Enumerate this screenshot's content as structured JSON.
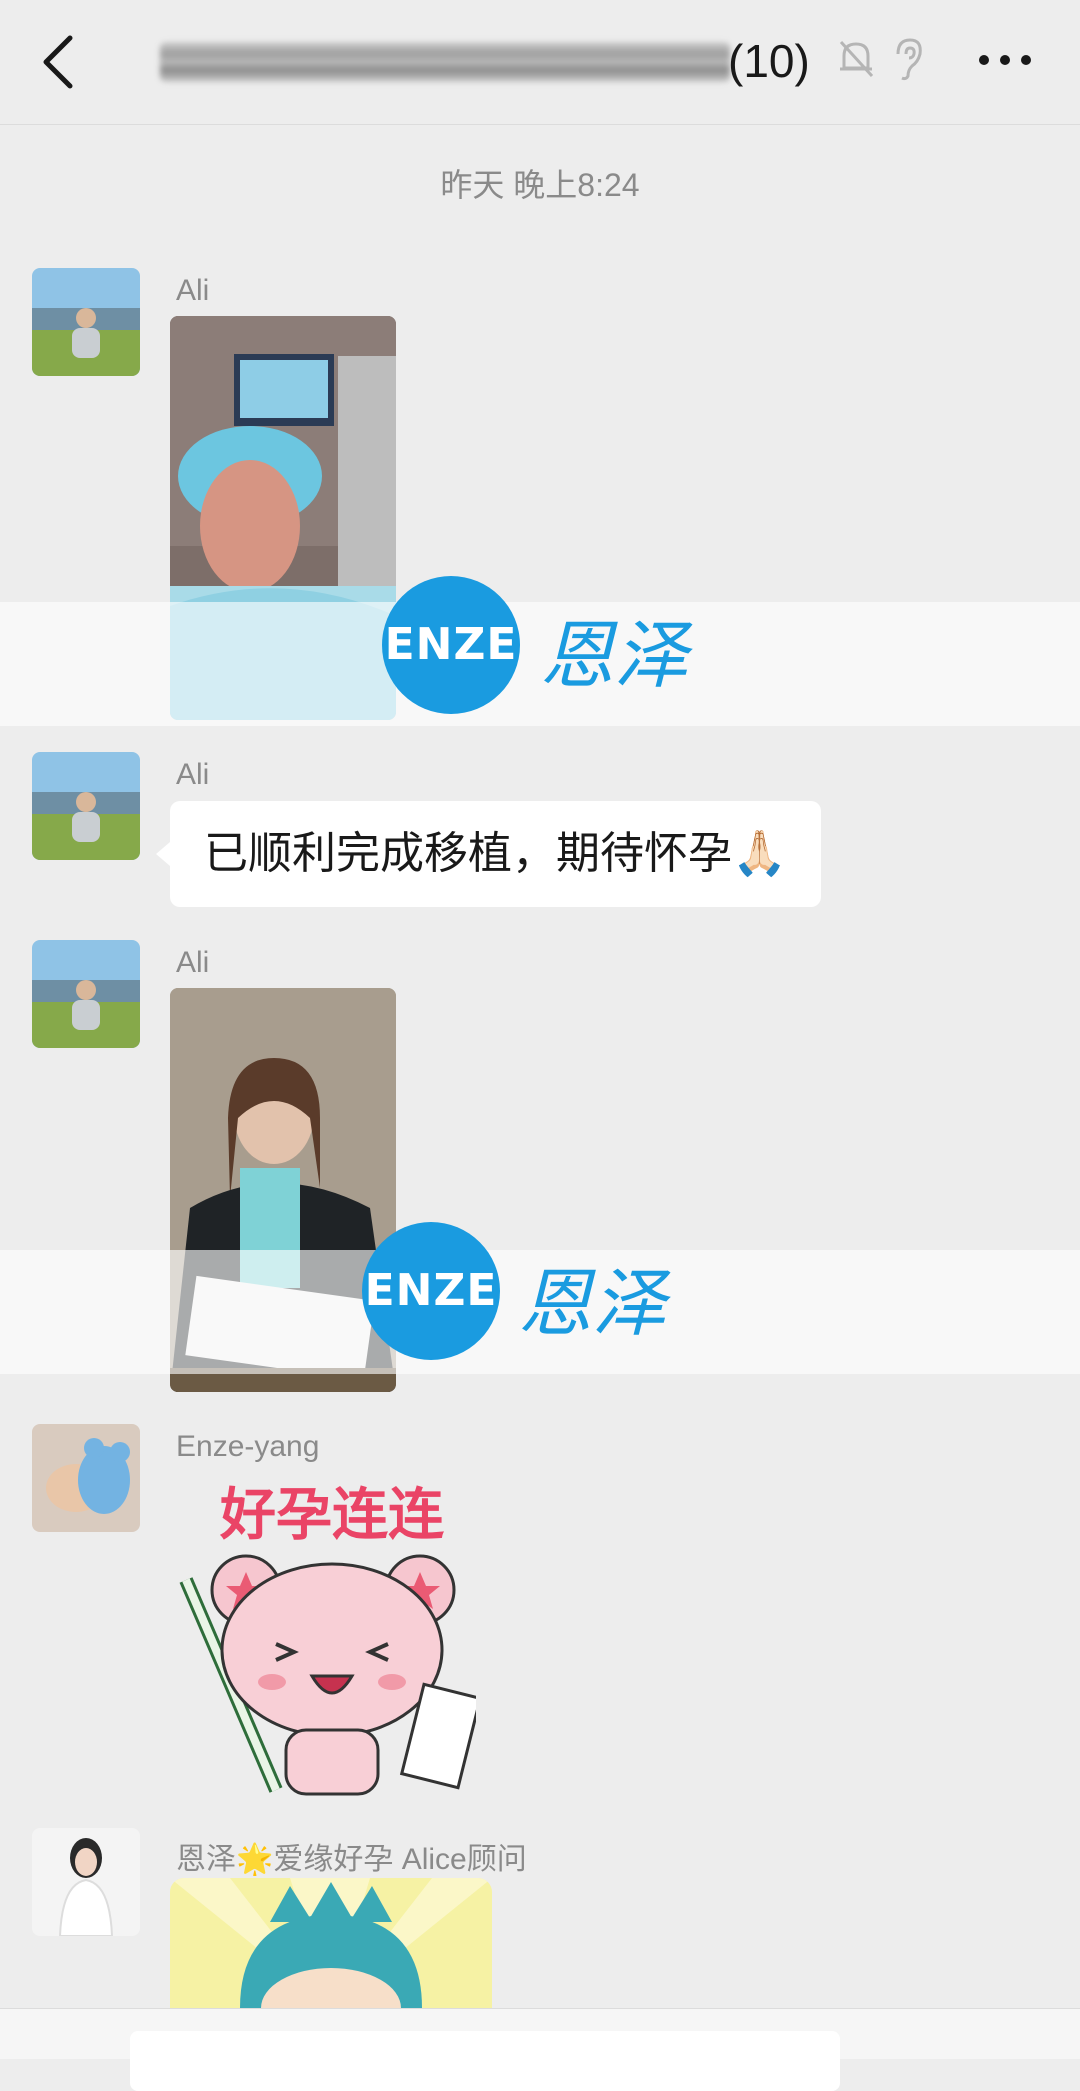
{
  "header": {
    "title_count": "(10)",
    "icons": [
      "back-icon",
      "mute-bell-icon",
      "ear-icon",
      "more-icon"
    ]
  },
  "chat": {
    "timestamp": "昨天 晚上8:24",
    "messages": [
      {
        "sender": "Ali",
        "type": "image"
      },
      {
        "sender": "Ali",
        "type": "text",
        "text": "已顺利完成移植，期待怀孕🙏🏻"
      },
      {
        "sender": "Ali",
        "type": "image"
      },
      {
        "sender": "Enze-yang",
        "type": "sticker",
        "sticker_text": "好孕连连"
      },
      {
        "sender": "恩泽🌟爱缘好孕 Alice顾问",
        "type": "sticker"
      }
    ]
  },
  "watermark": {
    "logo": "ENZE",
    "text": "恩泽"
  },
  "colors": {
    "background": "#ededed",
    "bubble": "#ffffff",
    "accent": "#1a9be0"
  }
}
